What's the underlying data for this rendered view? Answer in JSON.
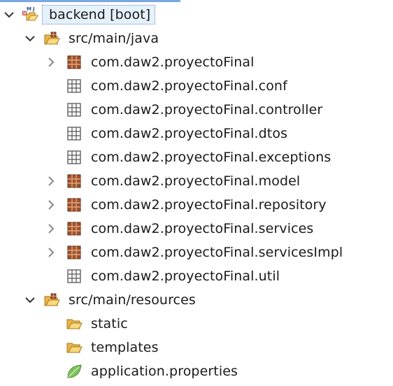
{
  "tree": {
    "project": {
      "label": "backend [boot]",
      "badge": "M J"
    },
    "src_main_java": {
      "label": "src/main/java",
      "packages": [
        {
          "label": "com.daw2.proyectoFinal",
          "expandable": true,
          "empty": false
        },
        {
          "label": "com.daw2.proyectoFinal.conf",
          "expandable": false,
          "empty": true
        },
        {
          "label": "com.daw2.proyectoFinal.controller",
          "expandable": false,
          "empty": true
        },
        {
          "label": "com.daw2.proyectoFinal.dtos",
          "expandable": false,
          "empty": true
        },
        {
          "label": "com.daw2.proyectoFinal.exceptions",
          "expandable": false,
          "empty": true
        },
        {
          "label": "com.daw2.proyectoFinal.model",
          "expandable": true,
          "empty": false
        },
        {
          "label": "com.daw2.proyectoFinal.repository",
          "expandable": true,
          "empty": false
        },
        {
          "label": "com.daw2.proyectoFinal.services",
          "expandable": true,
          "empty": false
        },
        {
          "label": "com.daw2.proyectoFinal.servicesImpl",
          "expandable": true,
          "empty": false
        },
        {
          "label": "com.daw2.proyectoFinal.util",
          "expandable": false,
          "empty": true
        }
      ]
    },
    "src_main_resources": {
      "label": "src/main/resources",
      "items": [
        {
          "label": "static",
          "icon": "folder-icon"
        },
        {
          "label": "templates",
          "icon": "folder-icon"
        },
        {
          "label": "application.properties",
          "icon": "leaf-icon"
        }
      ]
    }
  },
  "colors": {
    "selection_bg": "#e5f1fb",
    "package_fill": "#a0522d",
    "package_empty_stroke": "#555555",
    "folder_fill": "#f6d37a",
    "leaf_green": "#7cc25a"
  }
}
